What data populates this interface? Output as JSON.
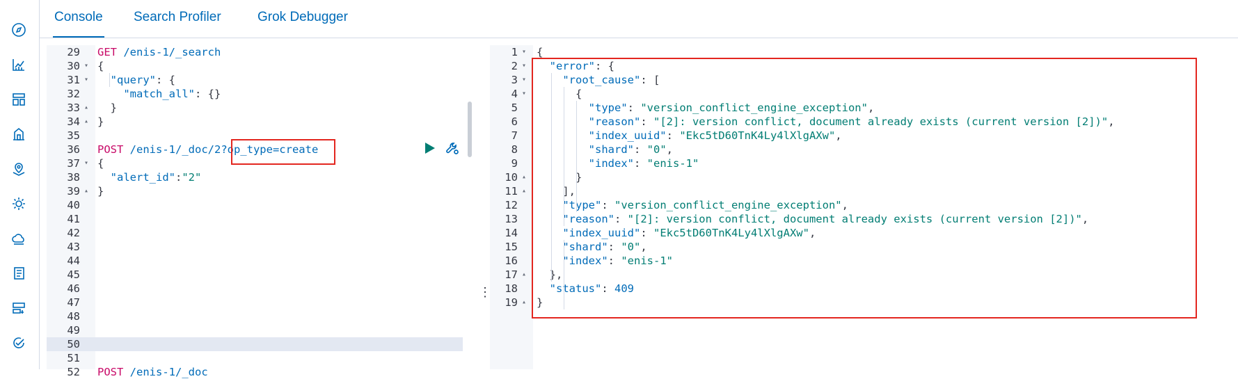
{
  "tabs": [
    {
      "label": "Console",
      "active": true
    },
    {
      "label": "Search Profiler",
      "active": false
    },
    {
      "label": "Grok Debugger",
      "active": false
    }
  ],
  "nav_icons": [
    "compass-icon",
    "chart-icon",
    "dashboard-icon",
    "building-icon",
    "map-icon",
    "ml-icon",
    "cloud-icon",
    "logs-icon",
    "infra-icon",
    "uptime-icon"
  ],
  "request_editor": {
    "lines": [
      {
        "n": "29",
        "fold": "",
        "code": [
          {
            "t": "GET ",
            "c": "k-method"
          },
          {
            "t": "/enis-1/_search",
            "c": "k-url"
          }
        ]
      },
      {
        "n": "30",
        "fold": "▾",
        "code": [
          {
            "t": "{",
            "c": "k-punc"
          }
        ]
      },
      {
        "n": "31",
        "fold": "▾",
        "code": [
          {
            "t": "  \"query\"",
            "c": "k-key"
          },
          {
            "t": ": {",
            "c": "k-punc"
          }
        ]
      },
      {
        "n": "32",
        "fold": "",
        "code": [
          {
            "t": "    \"match_all\"",
            "c": "k-key"
          },
          {
            "t": ": {}",
            "c": "k-punc"
          }
        ]
      },
      {
        "n": "33",
        "fold": "▴",
        "code": [
          {
            "t": "  }",
            "c": "k-punc"
          }
        ]
      },
      {
        "n": "34",
        "fold": "▴",
        "code": [
          {
            "t": "}",
            "c": "k-punc"
          }
        ]
      },
      {
        "n": "35",
        "fold": "",
        "code": []
      },
      {
        "n": "36",
        "fold": "",
        "code": [
          {
            "t": "POST ",
            "c": "k-method"
          },
          {
            "t": "/enis-1/_doc/2?op_type=create",
            "c": "k-url"
          }
        ]
      },
      {
        "n": "37",
        "fold": "▾",
        "code": [
          {
            "t": "{",
            "c": "k-punc"
          }
        ]
      },
      {
        "n": "38",
        "fold": "",
        "code": [
          {
            "t": "  \"alert_id\"",
            "c": "k-key"
          },
          {
            "t": ":",
            "c": "k-punc"
          },
          {
            "t": "\"2\"",
            "c": "k-str"
          }
        ]
      },
      {
        "n": "39",
        "fold": "▴",
        "code": [
          {
            "t": "}",
            "c": "k-punc"
          }
        ]
      },
      {
        "n": "40",
        "fold": "",
        "code": []
      },
      {
        "n": "41",
        "fold": "",
        "code": []
      },
      {
        "n": "42",
        "fold": "",
        "code": []
      },
      {
        "n": "43",
        "fold": "",
        "code": []
      },
      {
        "n": "44",
        "fold": "",
        "code": []
      },
      {
        "n": "45",
        "fold": "",
        "code": []
      },
      {
        "n": "46",
        "fold": "",
        "code": []
      },
      {
        "n": "47",
        "fold": "",
        "code": []
      },
      {
        "n": "48",
        "fold": "",
        "code": []
      },
      {
        "n": "49",
        "fold": "",
        "code": []
      },
      {
        "n": "50",
        "fold": "",
        "code": []
      },
      {
        "n": "51",
        "fold": "",
        "code": []
      },
      {
        "n": "52",
        "fold": "",
        "code": [
          {
            "t": "POST ",
            "c": "k-method"
          },
          {
            "t": "/enis-1/_doc",
            "c": "k-url"
          }
        ]
      }
    ]
  },
  "response_editor": {
    "lines": [
      {
        "n": "1",
        "fold": "▾",
        "code": [
          {
            "t": "{",
            "c": "k-punc"
          }
        ]
      },
      {
        "n": "2",
        "fold": "▾",
        "code": [
          {
            "t": "  \"error\"",
            "c": "k-key"
          },
          {
            "t": ": {",
            "c": "k-punc"
          }
        ]
      },
      {
        "n": "3",
        "fold": "▾",
        "code": [
          {
            "t": "    \"root_cause\"",
            "c": "k-key"
          },
          {
            "t": ": [",
            "c": "k-punc"
          }
        ]
      },
      {
        "n": "4",
        "fold": "▾",
        "code": [
          {
            "t": "      {",
            "c": "k-punc"
          }
        ]
      },
      {
        "n": "5",
        "fold": "",
        "code": [
          {
            "t": "        \"type\"",
            "c": "k-key"
          },
          {
            "t": ": ",
            "c": "k-punc"
          },
          {
            "t": "\"version_conflict_engine_exception\"",
            "c": "k-str"
          },
          {
            "t": ",",
            "c": "k-punc"
          }
        ]
      },
      {
        "n": "6",
        "fold": "",
        "code": [
          {
            "t": "        \"reason\"",
            "c": "k-key"
          },
          {
            "t": ": ",
            "c": "k-punc"
          },
          {
            "t": "\"[2]: version conflict, document already exists (current version [2])\"",
            "c": "k-str"
          },
          {
            "t": ",",
            "c": "k-punc"
          }
        ]
      },
      {
        "n": "7",
        "fold": "",
        "code": [
          {
            "t": "        \"index_uuid\"",
            "c": "k-key"
          },
          {
            "t": ": ",
            "c": "k-punc"
          },
          {
            "t": "\"Ekc5tD60TnK4Ly4lXlgAXw\"",
            "c": "k-str"
          },
          {
            "t": ",",
            "c": "k-punc"
          }
        ]
      },
      {
        "n": "8",
        "fold": "",
        "code": [
          {
            "t": "        \"shard\"",
            "c": "k-key"
          },
          {
            "t": ": ",
            "c": "k-punc"
          },
          {
            "t": "\"0\"",
            "c": "k-str"
          },
          {
            "t": ",",
            "c": "k-punc"
          }
        ]
      },
      {
        "n": "9",
        "fold": "",
        "code": [
          {
            "t": "        \"index\"",
            "c": "k-key"
          },
          {
            "t": ": ",
            "c": "k-punc"
          },
          {
            "t": "\"enis-1\"",
            "c": "k-str"
          }
        ]
      },
      {
        "n": "10",
        "fold": "▴",
        "code": [
          {
            "t": "      }",
            "c": "k-punc"
          }
        ]
      },
      {
        "n": "11",
        "fold": "▴",
        "code": [
          {
            "t": "    ],",
            "c": "k-punc"
          }
        ]
      },
      {
        "n": "12",
        "fold": "",
        "code": [
          {
            "t": "    \"type\"",
            "c": "k-key"
          },
          {
            "t": ": ",
            "c": "k-punc"
          },
          {
            "t": "\"version_conflict_engine_exception\"",
            "c": "k-str"
          },
          {
            "t": ",",
            "c": "k-punc"
          }
        ]
      },
      {
        "n": "13",
        "fold": "",
        "code": [
          {
            "t": "    \"reason\"",
            "c": "k-key"
          },
          {
            "t": ": ",
            "c": "k-punc"
          },
          {
            "t": "\"[2]: version conflict, document already exists (current version [2])\"",
            "c": "k-str"
          },
          {
            "t": ",",
            "c": "k-punc"
          }
        ]
      },
      {
        "n": "14",
        "fold": "",
        "code": [
          {
            "t": "    \"index_uuid\"",
            "c": "k-key"
          },
          {
            "t": ": ",
            "c": "k-punc"
          },
          {
            "t": "\"Ekc5tD60TnK4Ly4lXlgAXw\"",
            "c": "k-str"
          },
          {
            "t": ",",
            "c": "k-punc"
          }
        ]
      },
      {
        "n": "15",
        "fold": "",
        "code": [
          {
            "t": "    \"shard\"",
            "c": "k-key"
          },
          {
            "t": ": ",
            "c": "k-punc"
          },
          {
            "t": "\"0\"",
            "c": "k-str"
          },
          {
            "t": ",",
            "c": "k-punc"
          }
        ]
      },
      {
        "n": "16",
        "fold": "",
        "code": [
          {
            "t": "    \"index\"",
            "c": "k-key"
          },
          {
            "t": ": ",
            "c": "k-punc"
          },
          {
            "t": "\"enis-1\"",
            "c": "k-str"
          }
        ]
      },
      {
        "n": "17",
        "fold": "▴",
        "code": [
          {
            "t": "  },",
            "c": "k-punc"
          }
        ]
      },
      {
        "n": "18",
        "fold": "",
        "code": [
          {
            "t": "  \"status\"",
            "c": "k-key"
          },
          {
            "t": ": ",
            "c": "k-punc"
          },
          {
            "t": "409",
            "c": "k-num"
          }
        ]
      },
      {
        "n": "19",
        "fold": "▴",
        "code": [
          {
            "t": "}",
            "c": "k-punc"
          }
        ]
      }
    ]
  },
  "colors": {
    "accent": "#006bb8",
    "highlight_box": "#e3261f",
    "play": "#017d73"
  }
}
